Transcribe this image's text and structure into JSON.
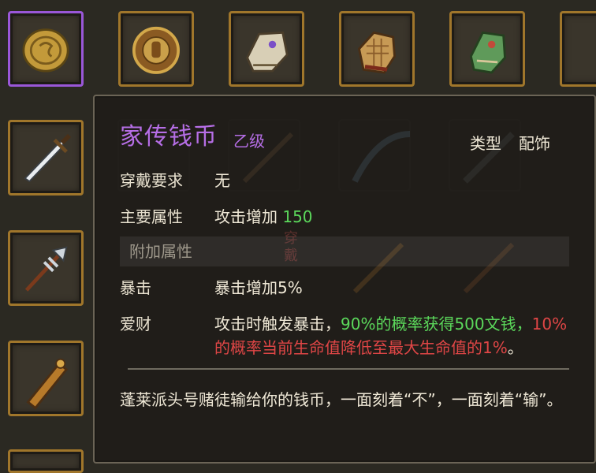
{
  "inventory": {
    "top_row": [
      {
        "icon": "coin-icon",
        "selected": true
      },
      {
        "icon": "round-shield-icon",
        "selected": false
      },
      {
        "icon": "jeweled-glove-icon",
        "selected": false
      },
      {
        "icon": "checkered-glove-icon",
        "selected": false
      },
      {
        "icon": "green-gauntlet-icon",
        "selected": false
      }
    ],
    "left_column": [
      {
        "icon": "sword-icon"
      },
      {
        "icon": "halberd-icon"
      },
      {
        "icon": "sheathed-dagger-icon"
      }
    ]
  },
  "tooltip": {
    "item_name": "家传钱币",
    "grade": "乙级",
    "type_label": "类型",
    "type_value": "配饰",
    "wear_req_label": "穿戴要求",
    "wear_req_value": "无",
    "main_attr_label": "主要属性",
    "main_attr_text": "攻击增加",
    "main_attr_value": "150",
    "extra_section_label": "附加属性",
    "crit_label": "暴击",
    "crit_value": "暴击增加5%",
    "special_label": "爱财",
    "special_part1": "攻击时触发暴击，",
    "special_part2": "90%的概率获得500文钱，",
    "special_part3": "10%的概率当前生命值降低至最大生命值的1%",
    "special_part4": "。",
    "flavor_text": "蓬莱派头号赌徒输给你的钱币，一面刻着“不”，一面刻着“输”。",
    "watermark": "穿戴"
  },
  "colors": {
    "purple_grade": "#b66ee6",
    "positive_green": "#5bd85b",
    "negative_red": "#e04646",
    "slot_border_gold": "#a0762b",
    "slot_border_selected": "#9a57d8"
  }
}
